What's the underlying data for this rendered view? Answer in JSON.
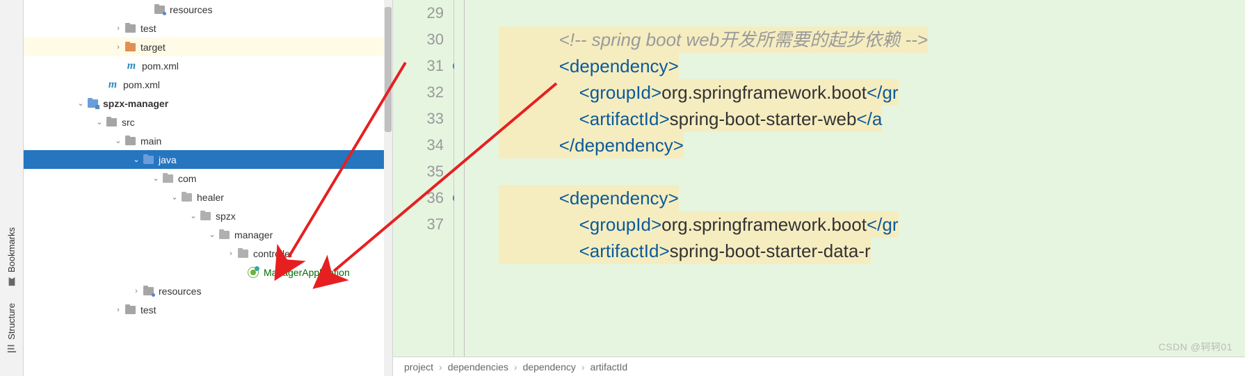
{
  "side_tabs": {
    "bookmarks": "Bookmarks",
    "structure": "Structure"
  },
  "tree": {
    "items": [
      {
        "indent": 170,
        "arrow": "",
        "iconType": "folder-resources",
        "label": "resources",
        "style": ""
      },
      {
        "indent": 128,
        "arrow": "right",
        "iconType": "folder",
        "label": "test",
        "style": ""
      },
      {
        "indent": 128,
        "arrow": "right",
        "iconType": "folder-orange",
        "label": "target",
        "style": "highlighted"
      },
      {
        "indent": 130,
        "arrow": "",
        "iconType": "m",
        "label": "pom.xml",
        "style": ""
      },
      {
        "indent": 103,
        "arrow": "",
        "iconType": "m",
        "label": "pom.xml",
        "style": ""
      },
      {
        "indent": 74,
        "arrow": "down",
        "iconType": "folder-module",
        "label": "spzx-manager",
        "style": "",
        "bold": true
      },
      {
        "indent": 101,
        "arrow": "down",
        "iconType": "folder",
        "label": "src",
        "style": ""
      },
      {
        "indent": 128,
        "arrow": "down",
        "iconType": "folder",
        "label": "main",
        "style": ""
      },
      {
        "indent": 154,
        "arrow": "down",
        "iconType": "folder-blue",
        "label": "java",
        "style": "selected"
      },
      {
        "indent": 182,
        "arrow": "down",
        "iconType": "folder-package",
        "label": "com",
        "style": ""
      },
      {
        "indent": 209,
        "arrow": "down",
        "iconType": "folder-package",
        "label": "healer",
        "style": ""
      },
      {
        "indent": 236,
        "arrow": "down",
        "iconType": "folder-package",
        "label": "spzx",
        "style": ""
      },
      {
        "indent": 263,
        "arrow": "down",
        "iconType": "folder-package",
        "label": "manager",
        "style": ""
      },
      {
        "indent": 290,
        "arrow": "right",
        "iconType": "folder-package",
        "label": "controller",
        "style": ""
      },
      {
        "indent": 305,
        "arrow": "",
        "iconType": "spring",
        "label": "ManagerApplication",
        "style": "",
        "green": true
      },
      {
        "indent": 154,
        "arrow": "right",
        "iconType": "folder-resources",
        "label": "resources",
        "style": ""
      },
      {
        "indent": 128,
        "arrow": "right",
        "iconType": "folder",
        "label": "test",
        "style": ""
      }
    ]
  },
  "gutter": {
    "lines": [
      "29",
      "30",
      "31",
      "32",
      "33",
      "34",
      "35",
      "36",
      "37",
      ""
    ],
    "marks": {
      "31": true,
      "36": true
    }
  },
  "code": {
    "lines": [
      {
        "raw": ""
      },
      {
        "hl": true,
        "tokens": [
          {
            "c": "comment",
            "t": "            <!-- spring boot web开发所需要的起步依赖 -->"
          }
        ]
      },
      {
        "hl": true,
        "tokens": [
          {
            "c": "text",
            "t": "            "
          },
          {
            "c": "bracket",
            "t": "<"
          },
          {
            "c": "tag",
            "t": "dependency"
          },
          {
            "c": "bracket",
            "t": ">"
          }
        ]
      },
      {
        "hl": true,
        "tokens": [
          {
            "c": "text",
            "t": "                "
          },
          {
            "c": "bracket",
            "t": "<"
          },
          {
            "c": "tag",
            "t": "groupId"
          },
          {
            "c": "bracket",
            "t": ">"
          },
          {
            "c": "text",
            "t": "org.springframework.boot"
          },
          {
            "c": "bracket",
            "t": "</"
          },
          {
            "c": "tag",
            "t": "gr"
          }
        ]
      },
      {
        "hl": true,
        "tokens": [
          {
            "c": "text",
            "t": "                "
          },
          {
            "c": "bracket",
            "t": "<"
          },
          {
            "c": "tag",
            "t": "artifactId"
          },
          {
            "c": "bracket",
            "t": ">"
          },
          {
            "c": "text",
            "t": "spring-boot-starter-web"
          },
          {
            "c": "bracket",
            "t": "</"
          },
          {
            "c": "tag",
            "t": "a"
          }
        ]
      },
      {
        "hl": true,
        "tokens": [
          {
            "c": "text",
            "t": "            "
          },
          {
            "c": "bracket",
            "t": "</"
          },
          {
            "c": "tag",
            "t": "dependency"
          },
          {
            "c": "bracket",
            "t": ">"
          }
        ]
      },
      {
        "raw": ""
      },
      {
        "hl": true,
        "tokens": [
          {
            "c": "text",
            "t": "            "
          },
          {
            "c": "bracket",
            "t": "<"
          },
          {
            "c": "tag",
            "t": "dependency"
          },
          {
            "c": "bracket",
            "t": ">"
          }
        ]
      },
      {
        "hl": true,
        "tokens": [
          {
            "c": "text",
            "t": "                "
          },
          {
            "c": "bracket",
            "t": "<"
          },
          {
            "c": "tag",
            "t": "groupId"
          },
          {
            "c": "bracket",
            "t": ">"
          },
          {
            "c": "text",
            "t": "org.springframework.boot"
          },
          {
            "c": "bracket",
            "t": "</"
          },
          {
            "c": "tag",
            "t": "gr"
          }
        ]
      },
      {
        "hl": true,
        "tokens": [
          {
            "c": "text",
            "t": "                "
          },
          {
            "c": "bracket",
            "t": "<"
          },
          {
            "c": "tag",
            "t": "artifactId"
          },
          {
            "c": "bracket",
            "t": ">"
          },
          {
            "c": "text",
            "t": "spring-boot-starter-data-r"
          }
        ]
      }
    ]
  },
  "breadcrumb": [
    "project",
    "dependencies",
    "dependency",
    "artifactId"
  ],
  "watermark": "CSDN @轲轲01"
}
